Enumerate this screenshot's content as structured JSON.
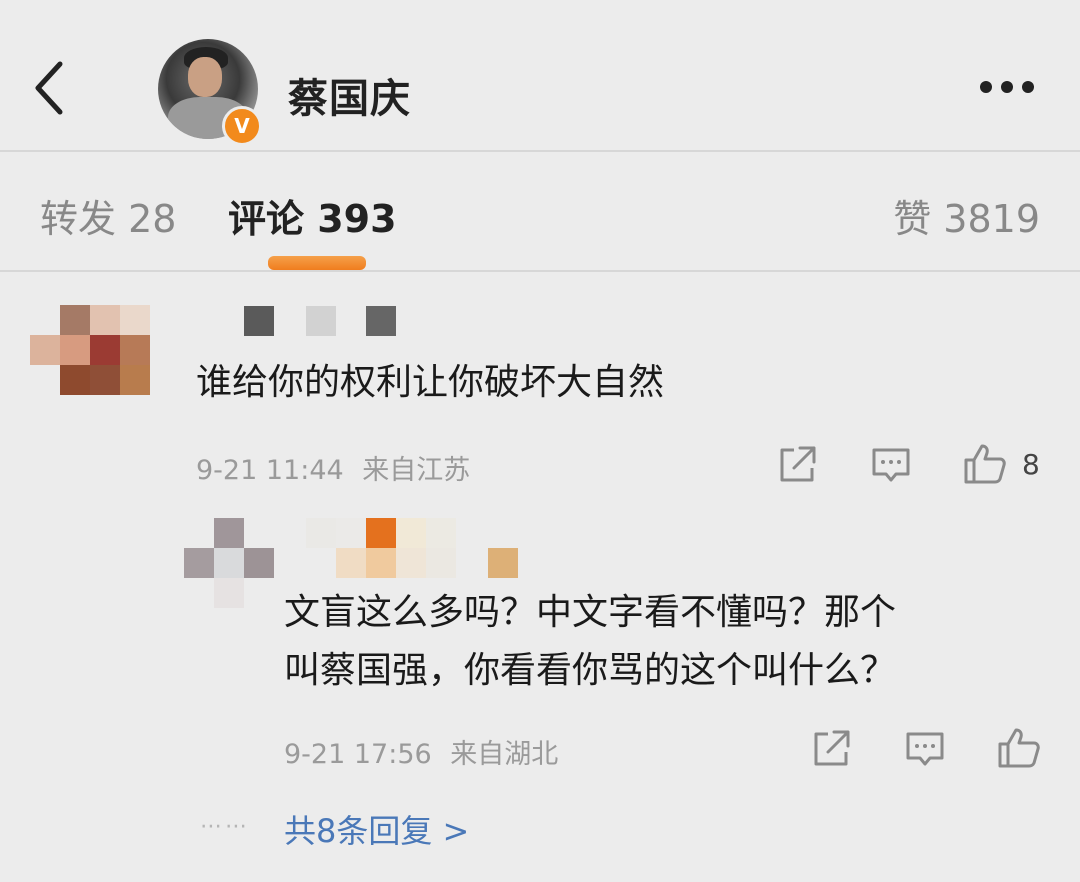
{
  "header": {
    "profile_name": "蔡国庆",
    "verified_badge": "V",
    "back_icon": "chevron-left-icon",
    "more_icon": "more-horizontal-icon"
  },
  "tabs": {
    "repost": "转发 28",
    "comments": "评论 393",
    "likes": "赞 3819"
  },
  "comments": [
    {
      "text": "谁给你的权利让你破坏大自然",
      "time": "9-21 11:44",
      "location": "来自江苏",
      "like_count": "8"
    }
  ],
  "reply": {
    "text_line1": "文盲这么多吗？中文字看不懂吗？那个",
    "text_line2": "叫蔡国强，你看看你骂的这个叫什么？",
    "time": "9-21 17:56",
    "location": "来自湖北"
  },
  "reply_summary": {
    "dots": "⋯⋯",
    "label": "共8条回复 >"
  },
  "colors": {
    "background": "#ececec",
    "accent_orange": "#f07d1e",
    "link_blue": "#4a78b8",
    "meta_gray": "#9a9a9a"
  }
}
